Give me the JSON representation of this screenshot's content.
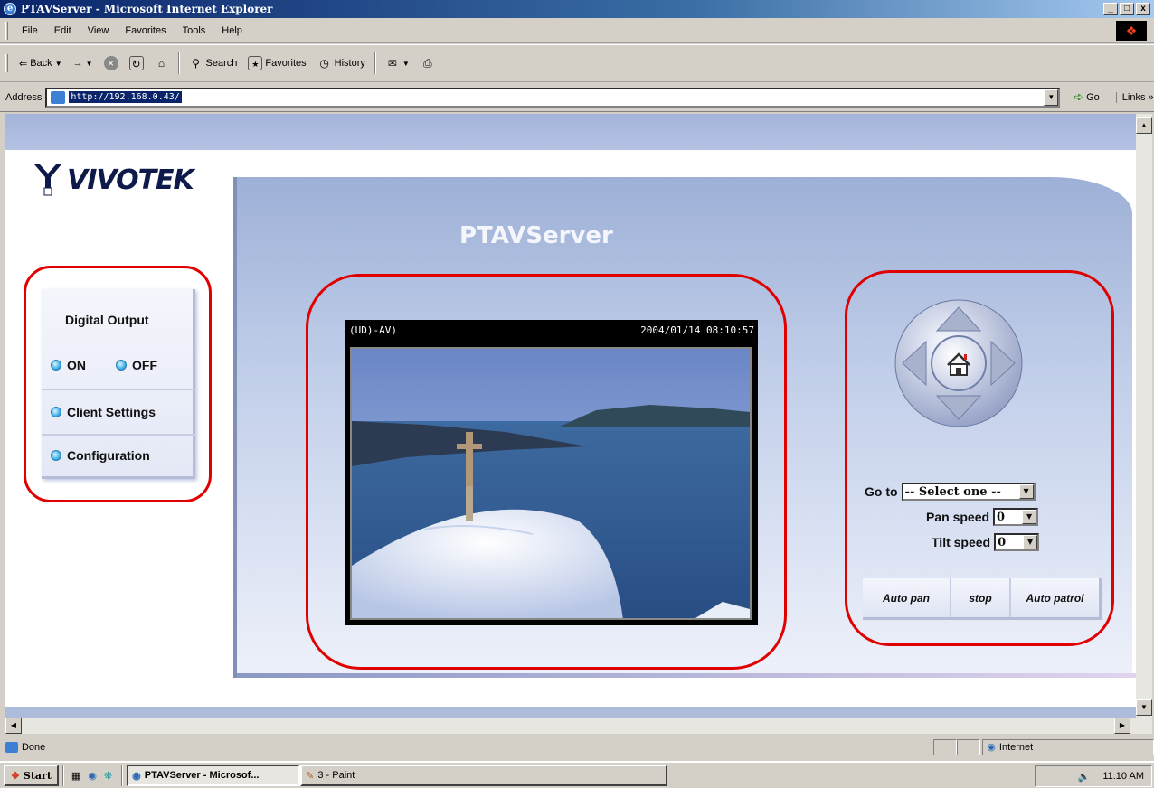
{
  "window": {
    "title": "PTAVServer - Microsoft Internet Explorer",
    "ctrl_min": "_",
    "ctrl_max": "□",
    "ctrl_close": "x"
  },
  "menu": [
    "File",
    "Edit",
    "View",
    "Favorites",
    "Tools",
    "Help"
  ],
  "toolbar": {
    "back": "Back",
    "search": "Search",
    "favorites": "Favorites",
    "history": "History"
  },
  "address": {
    "label": "Address",
    "url": "http://192.168.0.43/",
    "go": "Go",
    "links": "Links"
  },
  "page": {
    "logo": "VIVOTEK",
    "title": "PTAVServer",
    "left_panel": {
      "digital_output": "Digital Output",
      "on": "ON",
      "off": "OFF",
      "client_settings": "Client Settings",
      "configuration": "Configuration"
    },
    "video": {
      "channel": "(UD)-AV)",
      "timestamp": "2004/01/14 08:10:57"
    },
    "ptz": {
      "goto_label": "Go to",
      "goto_value": "-- Select one --",
      "pan_label": "Pan speed",
      "pan_value": "0",
      "tilt_label": "Tilt speed",
      "tilt_value": "0",
      "auto_pan": "Auto pan",
      "stop": "stop",
      "auto_patrol": "Auto patrol"
    }
  },
  "status": {
    "text": "Done",
    "zone": "Internet"
  },
  "taskbar": {
    "start": "Start",
    "task1": "PTAVServer - Microsof...",
    "task2": "3 - Paint",
    "clock": "11:10 AM"
  },
  "colors": {
    "annotation": "#e00000",
    "frame_blue": "#9db0d6",
    "logo_navy": "#0e1a4a"
  }
}
